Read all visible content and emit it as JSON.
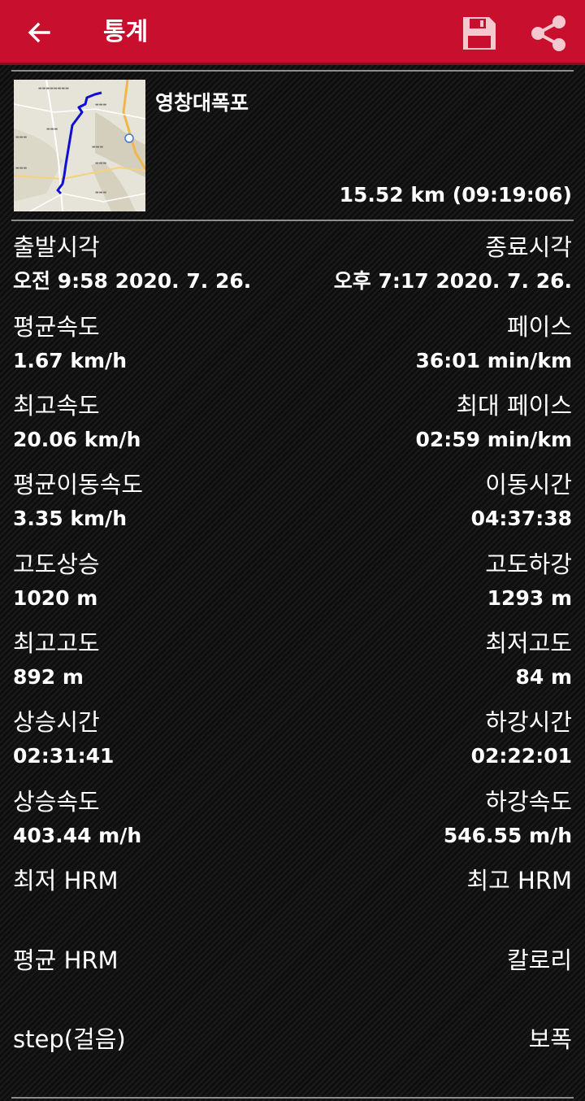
{
  "appbar": {
    "title": "통계",
    "accent_color": "#c8102e"
  },
  "route": {
    "name": "영창대폭포",
    "summary": "15.52 km (09:19:06)"
  },
  "stats": [
    {
      "left": {
        "label": "출발시각",
        "value": "오전 9:58 2020. 7. 26."
      },
      "right": {
        "label": "종료시각",
        "value": "오후 7:17 2020. 7. 26."
      }
    },
    {
      "left": {
        "label": "평균속도",
        "value": "1.67 km/h"
      },
      "right": {
        "label": "페이스",
        "value": "36:01 min/km"
      }
    },
    {
      "left": {
        "label": "최고속도",
        "value": "20.06 km/h"
      },
      "right": {
        "label": "최대 페이스",
        "value": "02:59 min/km"
      }
    },
    {
      "left": {
        "label": "평균이동속도",
        "value": "3.35 km/h"
      },
      "right": {
        "label": "이동시간",
        "value": "04:37:38"
      }
    },
    {
      "left": {
        "label": "고도상승",
        "value": "1020 m"
      },
      "right": {
        "label": "고도하강",
        "value": "1293 m"
      }
    },
    {
      "left": {
        "label": "최고고도",
        "value": "892 m"
      },
      "right": {
        "label": "최저고도",
        "value": "84 m"
      }
    },
    {
      "left": {
        "label": "상승시간",
        "value": "02:31:41"
      },
      "right": {
        "label": "하강시간",
        "value": "02:22:01"
      }
    },
    {
      "left": {
        "label": "상승속도",
        "value": "403.44 m/h"
      },
      "right": {
        "label": "하강속도",
        "value": "546.55 m/h"
      }
    },
    {
      "left": {
        "label": "최저 HRM",
        "value": ""
      },
      "right": {
        "label": "최고 HRM",
        "value": ""
      }
    },
    {
      "left": {
        "label": "평균 HRM",
        "value": ""
      },
      "right": {
        "label": "칼로리",
        "value": ""
      }
    },
    {
      "left": {
        "label": "step(걸음)",
        "value": ""
      },
      "right": {
        "label": "보폭",
        "value": ""
      }
    }
  ],
  "icons": {
    "back": "arrow-left-icon",
    "save": "floppy-disk-icon",
    "share": "share-icon"
  }
}
